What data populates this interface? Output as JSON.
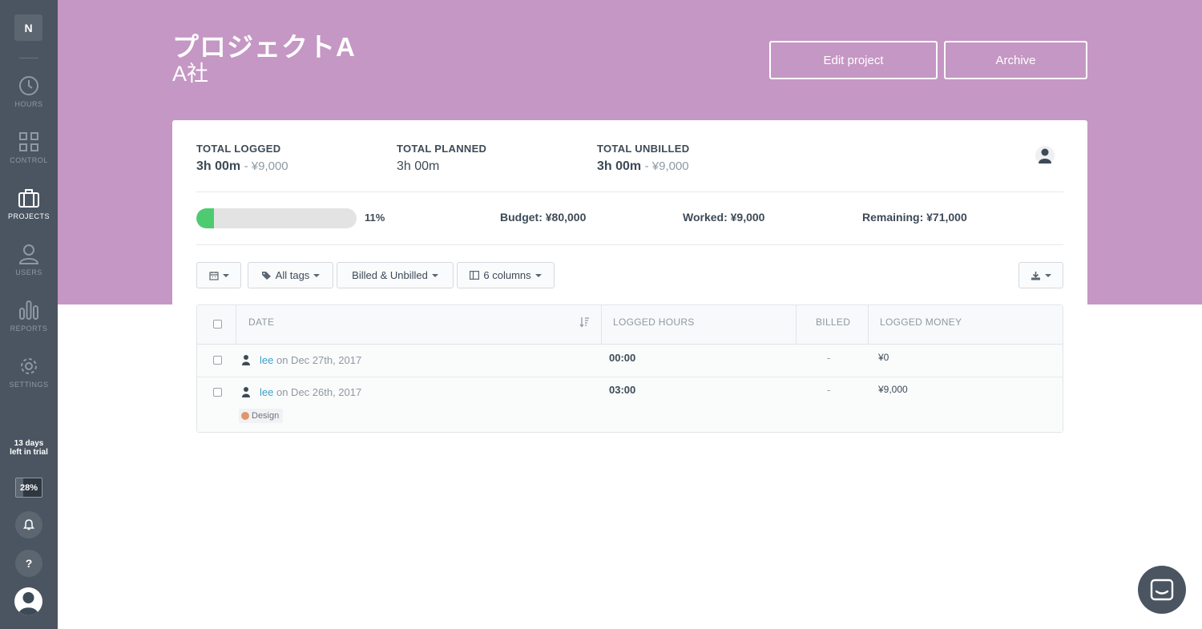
{
  "sidebar": {
    "workspace_initial": "N",
    "items": [
      {
        "label": "HOURS",
        "icon": "clock-icon"
      },
      {
        "label": "CONTROL",
        "icon": "grid-icon"
      },
      {
        "label": "PROJECTS",
        "icon": "briefcase-icon"
      },
      {
        "label": "USERS",
        "icon": "user-icon"
      },
      {
        "label": "REPORTS",
        "icon": "bar-chart-icon"
      },
      {
        "label": "SETTINGS",
        "icon": "gear-icon"
      }
    ],
    "active": "PROJECTS",
    "trial_line1": "13 days",
    "trial_line2": "left in trial",
    "trial_percent": "28%",
    "trial_fraction": 0.28,
    "help_label": "?"
  },
  "header": {
    "title": "プロジェクトA",
    "client": "A社",
    "edit_label": "Edit project",
    "archive_label": "Archive",
    "bg_color": "#c597c4"
  },
  "summary": {
    "total_logged_label": "TOTAL LOGGED",
    "total_logged_hours": "3h 00m",
    "total_logged_money": "- ¥9,000",
    "total_planned_label": "TOTAL PLANNED",
    "total_planned_hours": "3h 00m",
    "total_unbilled_label": "TOTAL UNBILLED",
    "total_unbilled_hours": "3h 00m",
    "total_unbilled_money": "- ¥9,000"
  },
  "budget": {
    "progress_percent": "11%",
    "progress_fraction": 0.11,
    "budget": "Budget: ¥80,000",
    "worked": "Worked: ¥9,000",
    "remaining": "Remaining: ¥71,000",
    "fill_color": "#4ecb71"
  },
  "filters": {
    "tags": "All tags",
    "billed": "Billed & Unbilled",
    "columns": "6 columns"
  },
  "table": {
    "headers": {
      "date": "DATE",
      "logged_hours": "LOGGED HOURS",
      "billed": "BILLED",
      "logged_money": "LOGGED MONEY"
    },
    "rows": [
      {
        "user": "lee",
        "date": "on Dec 27th, 2017",
        "hours": "00:00",
        "billed": "-",
        "money": "¥0",
        "tag": ""
      },
      {
        "user": "lee",
        "date": "on Dec 26th, 2017",
        "hours": "03:00",
        "billed": "-",
        "money": "¥9,000",
        "tag": "Design"
      }
    ]
  }
}
